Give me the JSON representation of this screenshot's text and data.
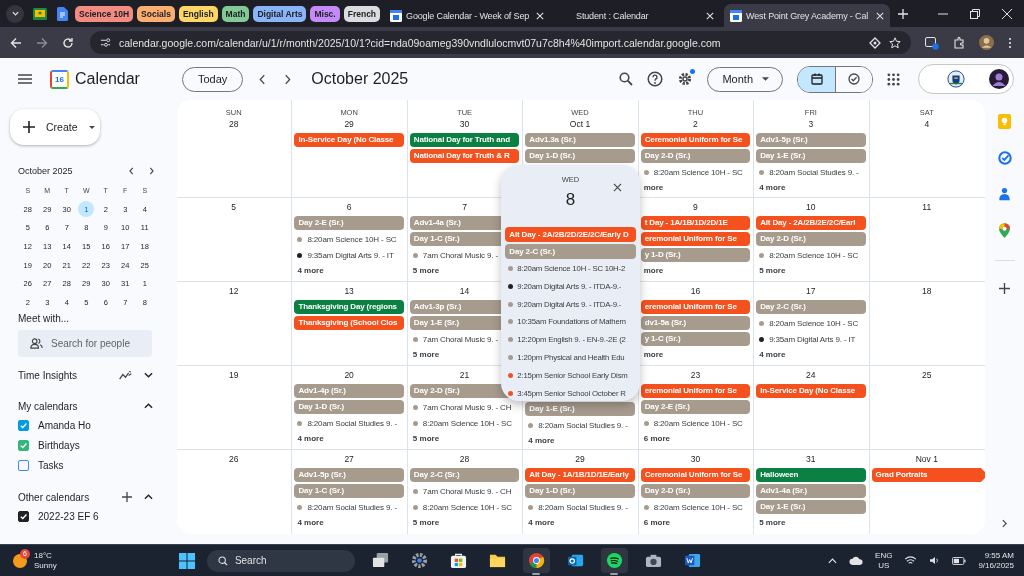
{
  "tab_strip": {
    "groups": [
      {
        "label": "Science 10H",
        "color": "#f28b82"
      },
      {
        "label": "Socials",
        "color": "#fcad70"
      },
      {
        "label": "English",
        "color": "#fdd663"
      },
      {
        "label": "Math",
        "color": "#81c995"
      },
      {
        "label": "Digital Arts",
        "color": "#8ab4f8"
      },
      {
        "label": "Misc.",
        "color": "#c58af9"
      },
      {
        "label": "French",
        "color": "#dadce0"
      }
    ],
    "tabs": [
      {
        "title": "Google Calendar - Week of Sep",
        "selected": false
      },
      {
        "title": "Student : Calendar",
        "selected": false
      },
      {
        "title": "West Point Grey Academy - Cal",
        "selected": true
      }
    ]
  },
  "address_bar": {
    "url": "calendar.google.com/calendar/u/1/r/month/2025/10/1?cid=nda09oameg390vndlulocmvt07u7c8h4%40import.calendar.google.com"
  },
  "header": {
    "logo_day": "16",
    "app_name": "Calendar",
    "today_button": "Today",
    "period": "October 2025",
    "settings_notice": true,
    "view_select": "Month",
    "view_toggle": [
      {
        "kind": "calendar",
        "selected": true
      },
      {
        "kind": "tasks",
        "selected": false
      }
    ]
  },
  "sidebar": {
    "create_button": "Create",
    "mini_calendar": {
      "title": "October 2025",
      "weekdays": [
        "S",
        "M",
        "T",
        "W",
        "T",
        "F",
        "S"
      ],
      "weeks": [
        [
          {
            "day": "28",
            "selected": false
          },
          {
            "day": "29",
            "selected": false
          },
          {
            "day": "30",
            "selected": false
          },
          {
            "day": "1",
            "selected": true
          },
          {
            "day": "2",
            "selected": false
          },
          {
            "day": "3",
            "selected": false
          },
          {
            "day": "4",
            "selected": false
          }
        ],
        [
          {
            "day": "5",
            "selected": false
          },
          {
            "day": "6",
            "selected": false
          },
          {
            "day": "7",
            "selected": false
          },
          {
            "day": "8",
            "selected": false
          },
          {
            "day": "9",
            "selected": false
          },
          {
            "day": "10",
            "selected": false
          },
          {
            "day": "11",
            "selected": false
          }
        ],
        [
          {
            "day": "12",
            "selected": false
          },
          {
            "day": "13",
            "selected": false
          },
          {
            "day": "14",
            "selected": false
          },
          {
            "day": "15",
            "selected": false
          },
          {
            "day": "16",
            "selected": false
          },
          {
            "day": "17",
            "selected": false
          },
          {
            "day": "18",
            "selected": false
          }
        ],
        [
          {
            "day": "19",
            "selected": false
          },
          {
            "day": "20",
            "selected": false
          },
          {
            "day": "21",
            "selected": false
          },
          {
            "day": "22",
            "selected": false
          },
          {
            "day": "23",
            "selected": false
          },
          {
            "day": "24",
            "selected": false
          },
          {
            "day": "25",
            "selected": false
          }
        ],
        [
          {
            "day": "26",
            "selected": false
          },
          {
            "day": "27",
            "selected": false
          },
          {
            "day": "28",
            "selected": false
          },
          {
            "day": "29",
            "selected": false
          },
          {
            "day": "30",
            "selected": false
          },
          {
            "day": "31",
            "selected": false
          },
          {
            "day": "1",
            "selected": false
          }
        ],
        [
          {
            "day": "2",
            "selected": false
          },
          {
            "day": "3",
            "selected": false
          },
          {
            "day": "4",
            "selected": false
          },
          {
            "day": "5",
            "selected": false
          },
          {
            "day": "6",
            "selected": false
          },
          {
            "day": "7",
            "selected": false
          },
          {
            "day": "8",
            "selected": false
          }
        ]
      ]
    },
    "meet_title": "Meet with...",
    "people_search": {
      "placeholder": "Search for people"
    },
    "time_insights": {
      "title": "Time Insights",
      "expanded": false
    },
    "my_calendars": {
      "title": "My calendars",
      "expanded": true,
      "items": [
        {
          "name": "Amanda Ho",
          "checked": true,
          "color": "#039be5"
        },
        {
          "name": "Birthdays",
          "checked": true,
          "color": "#33b679"
        },
        {
          "name": "Tasks",
          "checked": false,
          "color": "#4285f4"
        }
      ]
    },
    "other_calendars": {
      "title": "Other calendars",
      "expanded": true,
      "items": [
        {
          "name": "2022-23 EF 6",
          "checked": true,
          "color": "#202124"
        }
      ]
    }
  },
  "month": {
    "weekdays": [
      "SUN",
      "MON",
      "TUE",
      "WED",
      "THU",
      "FRI",
      "SAT"
    ],
    "weeks": [
      [
        {
          "kind": "day",
          "date": "28"
        },
        {
          "kind": "day",
          "date": "29",
          "items": [
            {
              "kind": "chip",
              "text": "In-Service Day (No Classe",
              "color": "#f4511e"
            }
          ]
        },
        {
          "kind": "day",
          "date": "30",
          "items": [
            {
              "kind": "chip",
              "text": "National Day for Truth and",
              "color": "#0b8043"
            },
            {
              "kind": "chip",
              "text": "National Day for Truth & R",
              "color": "#f4511e"
            }
          ]
        },
        {
          "kind": "day",
          "date": "Oct 1",
          "items": [
            {
              "kind": "chip",
              "text": "Adv1.3a (Sr.)",
              "color": "#a79b8e"
            },
            {
              "kind": "chip",
              "text": "Day 1-D (Sr.)",
              "color": "#a79b8e"
            }
          ]
        },
        {
          "kind": "day",
          "date": "2",
          "items": [
            {
              "kind": "chip",
              "text": "Ceremonial Uniform for Se",
              "color": "#f4511e"
            },
            {
              "kind": "chip",
              "text": "Day 2-D (Sr.)",
              "color": "#a79b8e"
            },
            {
              "kind": "timed",
              "text": "8:20am Science 10H - SC",
              "color": "#a79b8e"
            },
            {
              "kind": "more",
              "text": "more"
            }
          ]
        },
        {
          "kind": "day",
          "date": "3",
          "items": [
            {
              "kind": "chip",
              "text": "Adv1-5p (Sr.)",
              "color": "#a79b8e"
            },
            {
              "kind": "chip",
              "text": "Day 1-E (Sr.)",
              "color": "#a79b8e"
            },
            {
              "kind": "timed",
              "text": "8:20am Social Studies 9. -",
              "color": "#a79b8e"
            },
            {
              "kind": "more",
              "text": "4 more"
            }
          ]
        },
        {
          "kind": "day",
          "date": "4"
        }
      ],
      [
        {
          "kind": "day",
          "date": "5"
        },
        {
          "kind": "day",
          "date": "6",
          "items": [
            {
              "kind": "chip",
              "text": "Day 2-E (Sr.)",
              "color": "#a79b8e"
            },
            {
              "kind": "timed",
              "text": "8:20am Science 10H - SC",
              "color": "#a79b8e"
            },
            {
              "kind": "timed",
              "text": "9:35am Digital Arts 9. - IT",
              "color": "#202124"
            },
            {
              "kind": "more",
              "text": "4 more"
            }
          ]
        },
        {
          "kind": "day",
          "date": "7",
          "items": [
            {
              "kind": "chip",
              "text": "Adv1-4a (Sr.)",
              "color": "#a79b8e"
            },
            {
              "kind": "chip",
              "text": "Day 1-C (Sr.)",
              "color": "#a79b8e"
            },
            {
              "kind": "timed",
              "text": "7am Choral Music 9. -",
              "color": "#a79b8e"
            },
            {
              "kind": "more",
              "text": "5 more"
            }
          ]
        },
        {
          "kind": "covered"
        },
        {
          "kind": "day",
          "date": "9",
          "items": [
            {
              "kind": "chip",
              "text": "t Day - 1A/1B/1D/2D/1E",
              "color": "#f4511e"
            },
            {
              "kind": "chip",
              "text": "eremonial Uniform for Se",
              "color": "#f4511e"
            },
            {
              "kind": "chip",
              "text": "y 1-D (Sr.)",
              "color": "#a79b8e"
            },
            {
              "kind": "more",
              "text": "more"
            }
          ]
        },
        {
          "kind": "day",
          "date": "10",
          "items": [
            {
              "kind": "chip",
              "text": "Alt Day - 2A/2B/2E/2C/Earl",
              "color": "#f4511e"
            },
            {
              "kind": "chip",
              "text": "Day 2-D (Sr.)",
              "color": "#a79b8e"
            },
            {
              "kind": "timed",
              "text": "8:20am Science 10H - SC",
              "color": "#a79b8e"
            },
            {
              "kind": "more",
              "text": "5 more"
            }
          ]
        },
        {
          "kind": "day",
          "date": "11"
        }
      ],
      [
        {
          "kind": "day",
          "date": "12"
        },
        {
          "kind": "day",
          "date": "13",
          "items": [
            {
              "kind": "chip",
              "text": "Thanksgiving Day (regions",
              "color": "#0b8043"
            },
            {
              "kind": "chip",
              "text": "Thanksgiving (School Clos",
              "color": "#f4511e"
            }
          ]
        },
        {
          "kind": "day",
          "date": "14",
          "items": [
            {
              "kind": "chip",
              "text": "Adv1-3p (Sr.)",
              "color": "#a79b8e"
            },
            {
              "kind": "chip",
              "text": "Day 1-E (Sr.)",
              "color": "#a79b8e"
            },
            {
              "kind": "timed",
              "text": "7am Choral Music 9. -",
              "color": "#a79b8e"
            },
            {
              "kind": "more",
              "text": "5 more"
            }
          ]
        },
        {
          "kind": "covered"
        },
        {
          "kind": "day",
          "date": "16",
          "items": [
            {
              "kind": "chip",
              "text": "eremonial Uniform for Se",
              "color": "#f4511e"
            },
            {
              "kind": "chip",
              "text": "dv1-5a (Sr.)",
              "color": "#a79b8e"
            },
            {
              "kind": "chip",
              "text": "y 1-C (Sr.)",
              "color": "#a79b8e"
            },
            {
              "kind": "more",
              "text": "more"
            }
          ]
        },
        {
          "kind": "day",
          "date": "17",
          "items": [
            {
              "kind": "chip",
              "text": "Day 2-C (Sr.)",
              "color": "#a79b8e"
            },
            {
              "kind": "timed",
              "text": "8:20am Science 10H - SC",
              "color": "#a79b8e"
            },
            {
              "kind": "timed",
              "text": "9:35am Digital Arts 9. - IT",
              "color": "#202124"
            },
            {
              "kind": "more",
              "text": "4 more"
            }
          ]
        },
        {
          "kind": "day",
          "date": "18"
        }
      ],
      [
        {
          "kind": "day",
          "date": "19"
        },
        {
          "kind": "day",
          "date": "20",
          "items": [
            {
              "kind": "chip",
              "text": "Adv1-4p (Sr.)",
              "color": "#a79b8e"
            },
            {
              "kind": "chip",
              "text": "Day 1-D (Sr.)",
              "color": "#a79b8e"
            },
            {
              "kind": "timed",
              "text": "8:20am Social Studies 9. -",
              "color": "#a79b8e"
            },
            {
              "kind": "more",
              "text": "4 more"
            }
          ]
        },
        {
          "kind": "day",
          "date": "21",
          "items": [
            {
              "kind": "chip",
              "text": "Day 2-D (Sr.)",
              "color": "#a79b8e"
            },
            {
              "kind": "timed",
              "text": "7am Choral Music 9. - CH",
              "color": "#a79b8e"
            },
            {
              "kind": "timed",
              "text": "8:20am Science 10H - SC",
              "color": "#a79b8e"
            },
            {
              "kind": "more",
              "text": "5 more"
            }
          ]
        },
        {
          "kind": "partly_covered",
          "items": [
            {
              "kind": "chip",
              "text": "Day 1-E (Sr.)",
              "color": "#a79b8e"
            },
            {
              "kind": "timed",
              "text": "8:20am Social Studies 9. -",
              "color": "#a79b8e"
            },
            {
              "kind": "more",
              "text": "4 more"
            }
          ]
        },
        {
          "kind": "day",
          "date": "23",
          "items": [
            {
              "kind": "chip",
              "text": "eremonial Uniform for Se",
              "color": "#f4511e"
            },
            {
              "kind": "chip",
              "text": "Day 2-E (Sr.)",
              "color": "#a79b8e"
            },
            {
              "kind": "timed",
              "text": "8:20am Science 10H - SC",
              "color": "#a79b8e"
            },
            {
              "kind": "more",
              "text": "6 more"
            }
          ]
        },
        {
          "kind": "day",
          "date": "24",
          "items": [
            {
              "kind": "chip",
              "text": "In-Service Day (No Classe",
              "color": "#f4511e"
            }
          ]
        },
        {
          "kind": "day",
          "date": "25"
        }
      ],
      [
        {
          "kind": "day",
          "date": "26"
        },
        {
          "kind": "day",
          "date": "27",
          "items": [
            {
              "kind": "chip",
              "text": "Adv1-5p (Sr.)",
              "color": "#a79b8e"
            },
            {
              "kind": "chip",
              "text": "Day 1-C (Sr.)",
              "color": "#a79b8e"
            },
            {
              "kind": "timed",
              "text": "8:20am Social Studies 9. -",
              "color": "#a79b8e"
            },
            {
              "kind": "more",
              "text": "4 more"
            }
          ]
        },
        {
          "kind": "day",
          "date": "28",
          "items": [
            {
              "kind": "chip",
              "text": "Day 2-C (Sr.)",
              "color": "#a79b8e"
            },
            {
              "kind": "timed",
              "text": "7am Choral Music 9. - CH",
              "color": "#a79b8e"
            },
            {
              "kind": "timed",
              "text": "8:20am Science 10H - SC",
              "color": "#a79b8e"
            },
            {
              "kind": "more",
              "text": "5 more"
            }
          ]
        },
        {
          "kind": "day",
          "date": "29",
          "items": [
            {
              "kind": "chip",
              "text": "Alt Day - 1A/1B/1D/1E/Early",
              "color": "#f4511e"
            },
            {
              "kind": "chip",
              "text": "Day 1-D (Sr.)",
              "color": "#a79b8e"
            },
            {
              "kind": "timed",
              "text": "8:20am Social Studies 9. -",
              "color": "#a79b8e"
            },
            {
              "kind": "more",
              "text": "4 more"
            }
          ]
        },
        {
          "kind": "day",
          "date": "30",
          "items": [
            {
              "kind": "chip",
              "text": "Ceremonial Uniform for Se",
              "color": "#f4511e"
            },
            {
              "kind": "chip",
              "text": "Day 2-D (Sr.)",
              "color": "#a79b8e"
            },
            {
              "kind": "timed",
              "text": "8:20am Science 10H - SC",
              "color": "#a79b8e"
            },
            {
              "kind": "more",
              "text": "6 more"
            }
          ]
        },
        {
          "kind": "day",
          "date": "31",
          "items": [
            {
              "kind": "chip",
              "text": "Halloween",
              "color": "#0b8043"
            },
            {
              "kind": "chip",
              "text": "Adv1-4a (Sr.)",
              "color": "#a79b8e"
            },
            {
              "kind": "chip",
              "text": "Day 1-E (Sr.)",
              "color": "#a79b8e"
            },
            {
              "kind": "more",
              "text": "5 more"
            }
          ]
        },
        {
          "kind": "day",
          "date": "Nov 1",
          "items": [
            {
              "kind": "multiday",
              "text": "Grad Portraits",
              "color": "#f4511e"
            }
          ]
        }
      ]
    ]
  },
  "day_popup": {
    "weekday": "WED",
    "date": "8",
    "items": [
      {
        "kind": "chip",
        "text": "Alt Day - 2A/2B/2D/2E/2C/Early D",
        "color": "#f4511e"
      },
      {
        "kind": "chip",
        "text": "Day 2-C (Sr.)",
        "color": "#a79b8e"
      },
      {
        "kind": "timed",
        "text": "8:20am Science 10H - SC 10H-2",
        "color": "#a79b8e"
      },
      {
        "kind": "timed",
        "text": "9:20am Digital Arts 9. - ITDA-9.-",
        "color": "#202124"
      },
      {
        "kind": "timed",
        "text": "9:20am Digital Arts 9. - ITDA-9.-",
        "color": "#a79b8e"
      },
      {
        "kind": "timed",
        "text": "10:35am Foundations of Mathem",
        "color": "#a79b8e"
      },
      {
        "kind": "timed",
        "text": "12:20pm English 9. - EN-9.-2E (2",
        "color": "#a79b8e"
      },
      {
        "kind": "timed",
        "text": "1:20pm Physical and Health Edu",
        "color": "#a79b8e"
      },
      {
        "kind": "timed",
        "text": "2:15pm Senior School Early Dism",
        "color": "#f4511e"
      },
      {
        "kind": "timed",
        "text": "3:45pm Senior School October R",
        "color": "#f4511e"
      }
    ]
  },
  "taskbar": {
    "weather": {
      "badge": "6",
      "temp": "18°C",
      "condition": "Sunny"
    },
    "search": {
      "placeholder": "Search"
    },
    "apps": [
      {
        "kind": "taskview",
        "running": false
      },
      {
        "kind": "settings",
        "running": false
      },
      {
        "kind": "store",
        "running": false
      },
      {
        "kind": "files",
        "running": false
      },
      {
        "kind": "chrome",
        "running": true
      },
      {
        "kind": "outlook",
        "running": false
      },
      {
        "kind": "spotify",
        "running": true
      },
      {
        "kind": "camera",
        "running": false
      },
      {
        "kind": "word",
        "running": false
      }
    ],
    "language": "ENG",
    "region": "US",
    "time": "9:55 AM",
    "date": "9/16/2025"
  }
}
